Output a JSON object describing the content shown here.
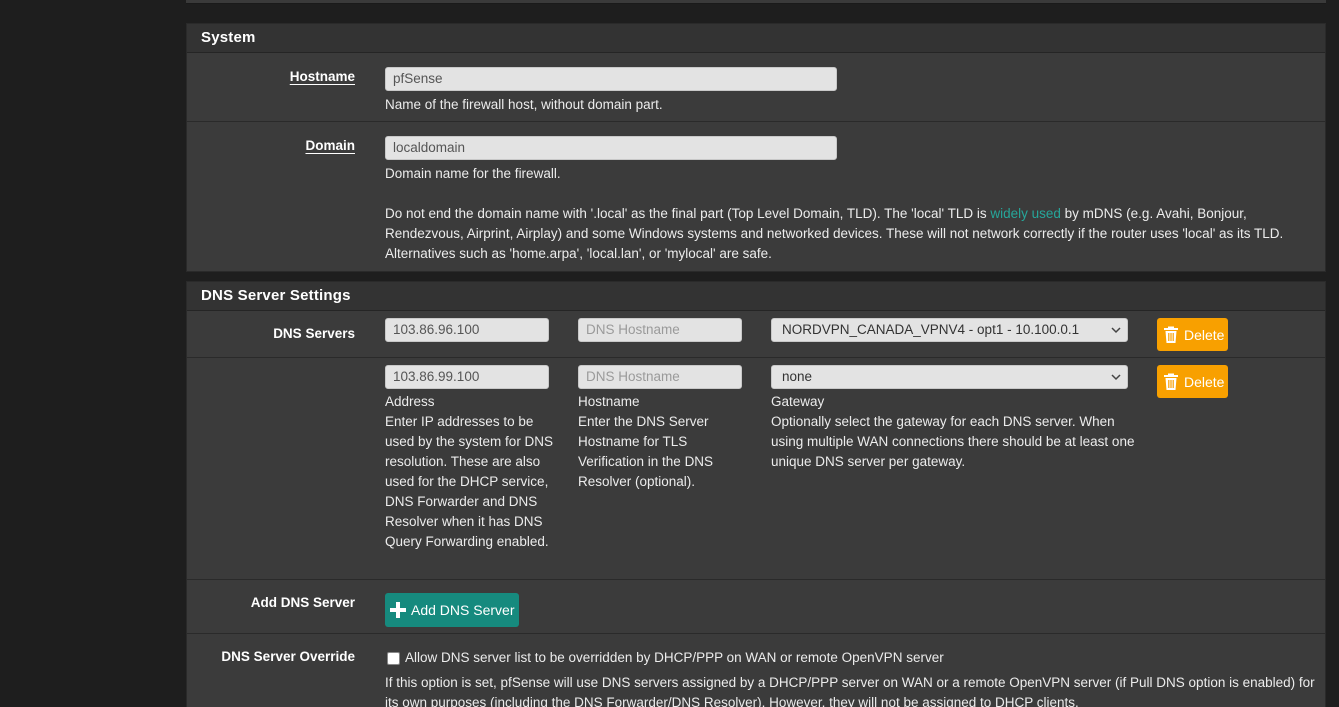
{
  "system": {
    "title": "System",
    "hostname": {
      "label": "Hostname",
      "value": "pfSense",
      "help": "Name of the firewall host, without domain part."
    },
    "domain": {
      "label": "Domain",
      "value": "localdomain",
      "help": "Domain name for the firewall.",
      "note_before_link": "Do not end the domain name with '.local' as the final part (Top Level Domain, TLD). The 'local' TLD is ",
      "note_link": "widely used",
      "note_after_link": " by mDNS (e.g. Avahi, Bonjour, Rendezvous, Airprint, Airplay) and some Windows systems and networked devices. These will not network correctly if the router uses 'local' as its TLD. Alternatives such as 'home.arpa', 'local.lan', or 'mylocal' are safe."
    }
  },
  "dns_settings": {
    "title": "DNS Server Settings",
    "servers_label": "DNS Servers",
    "servers": [
      {
        "address": "103.86.96.100",
        "hostname_placeholder": "DNS Hostname",
        "gateway": "NORDVPN_CANADA_VPNV4 - opt1 - 10.100.0.1",
        "delete_label": "Delete"
      },
      {
        "address": "103.86.99.100",
        "hostname_placeholder": "DNS Hostname",
        "gateway": "none",
        "delete_label": "Delete"
      }
    ],
    "address_help_title": "Address",
    "address_help": "Enter IP addresses to be used by the system for DNS resolution. These are also used for the DHCP service, DNS Forwarder and DNS Resolver when it has DNS Query Forwarding enabled.",
    "hostname_help_title": "Hostname",
    "hostname_help": "Enter the DNS Server Hostname for TLS Verification in the DNS Resolver (optional).",
    "gateway_help_title": "Gateway",
    "gateway_help": "Optionally select the gateway for each DNS server. When using multiple WAN connections there should be at least one unique DNS server per gateway.",
    "add_label": "Add DNS Server",
    "add_button": "Add DNS Server",
    "override_label": "DNS Server Override",
    "override_checkbox_text": "Allow DNS server list to be overridden by DHCP/PPP on WAN or remote OpenVPN server",
    "override_checked": false,
    "override_help": "If this option is set, pfSense will use DNS servers assigned by a DHCP/PPP server on WAN or a remote OpenVPN server (if Pull DNS option is enabled) for its own purposes (including the DNS Forwarder/DNS Resolver). However, they will not be assigned to DHCP clients."
  },
  "colors": {
    "delete_button": "#f8a000",
    "add_button": "#168a7e",
    "link": "#26a69a"
  },
  "icons": {
    "delete": "trash-icon",
    "add": "plus-icon",
    "select": "chevron-down-icon"
  }
}
